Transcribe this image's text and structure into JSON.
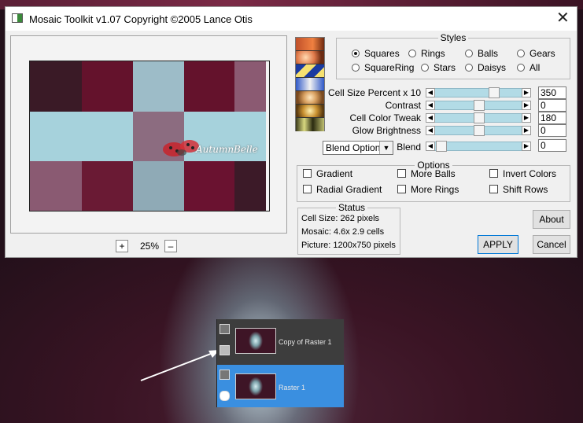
{
  "window": {
    "title": "Mosaic Toolkit v1.07  Copyright ©2005 Lance Otis",
    "close_glyph": "✕"
  },
  "preview": {
    "zoom_in": "+",
    "zoom_value": "25%",
    "zoom_out": "–",
    "watermark": "AutumnBelle",
    "tiles": [
      "#3a1a26",
      "#64122c",
      "#9dbcc8",
      "#64122c",
      "#8b5a72",
      "#a6d2dc",
      "#a6d2dc",
      "#8c6c80",
      "#a6d2dc",
      "#a6d2dc",
      "#8a5a72",
      "#6a1a34",
      "#8faab6",
      "#6a1230",
      "#3c1a28"
    ]
  },
  "styles": {
    "title": "Styles",
    "options": [
      {
        "label": "Squares",
        "selected": true
      },
      {
        "label": "Rings",
        "selected": false
      },
      {
        "label": "Balls",
        "selected": false
      },
      {
        "label": "Gears",
        "selected": false
      },
      {
        "label": "SquareRing",
        "selected": false
      },
      {
        "label": "Stars",
        "selected": false
      },
      {
        "label": "Daisys",
        "selected": false
      },
      {
        "label": "All",
        "selected": false
      }
    ]
  },
  "sliders": [
    {
      "label": "Cell Size Percent x 10",
      "value": "350",
      "level": 0.7
    },
    {
      "label": "Contrast",
      "value": "0",
      "level": 0.5
    },
    {
      "label": "Cell Color Tweak",
      "value": "180",
      "level": 0.5
    },
    {
      "label": "Glow Brightness",
      "value": "0",
      "level": 0.5
    }
  ],
  "blend": {
    "dropdown": "Blend Options",
    "label": "Blend",
    "value": "0",
    "level": 0.0
  },
  "options": {
    "title": "Options",
    "items": [
      {
        "label": "Gradient",
        "checked": false
      },
      {
        "label": "More Balls",
        "checked": false
      },
      {
        "label": "Invert Colors",
        "checked": false
      },
      {
        "label": "Radial Gradient",
        "checked": false
      },
      {
        "label": "More Rings",
        "checked": false
      },
      {
        "label": "Shift Rows",
        "checked": false
      }
    ]
  },
  "status": {
    "title": "Status",
    "cell_size": "Cell Size: 262 pixels",
    "mosaic": "Mosaic:   4.6x  2.9 cells",
    "picture": "Picture:  1200x750 pixels"
  },
  "buttons": {
    "about": "About",
    "apply": "APPLY",
    "cancel": "Cancel"
  },
  "layers": [
    {
      "name": "Copy of Raster 1",
      "selected": false
    },
    {
      "name": "Raster 1",
      "selected": true
    }
  ]
}
